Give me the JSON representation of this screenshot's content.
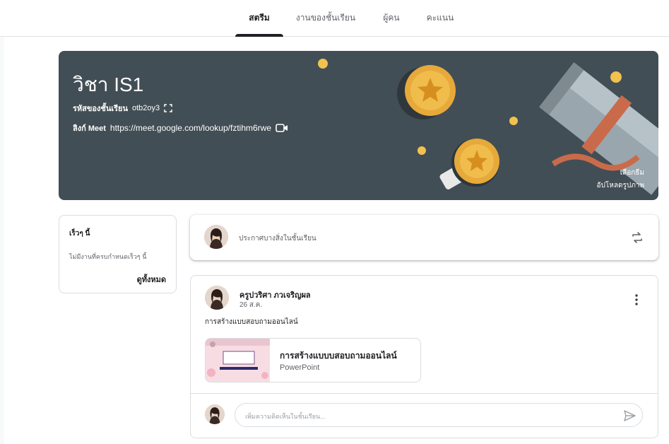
{
  "nav": {
    "tabs": [
      {
        "label": "สตรีม",
        "active": true
      },
      {
        "label": "งานของชั้นเรียน",
        "active": false
      },
      {
        "label": "ผู้คน",
        "active": false
      },
      {
        "label": "คะแนน",
        "active": false
      }
    ]
  },
  "banner": {
    "title": "วิชา IS1",
    "code_label": "รหัสของชั้นเรียน",
    "code_value": "otb2oy3",
    "meet_label": "ลิงก์ Meet",
    "meet_url": "https://meet.google.com/lookup/fztihm6rwe",
    "select_theme": "เลือกธีม",
    "upload_photo": "อัปโหลดรูปภาพ",
    "background_color": "#424e55"
  },
  "upcoming": {
    "title": "เร็วๆ นี้",
    "empty_text": "ไม่มีงานที่ครบกำหนดเร็วๆ นี้",
    "view_all": "ดูทั้งหมด"
  },
  "announce": {
    "placeholder": "ประกาศบางสิ่งในชั้นเรียน"
  },
  "post": {
    "author": "ครูปวริศา ภวเจริญผล",
    "date": "26 ส.ค.",
    "text": "การสร้างแบบสอบถามออนไลน์",
    "attachment": {
      "title": "การสร้างแบบบสอบถามออนไลน์",
      "type": "PowerPoint"
    },
    "comment_placeholder": "เพิ่มความคิดเห็นในชั้นเรียน..."
  },
  "colors": {
    "accent": "#202124",
    "banner": "#424e55",
    "medal": "#e6a93a"
  }
}
